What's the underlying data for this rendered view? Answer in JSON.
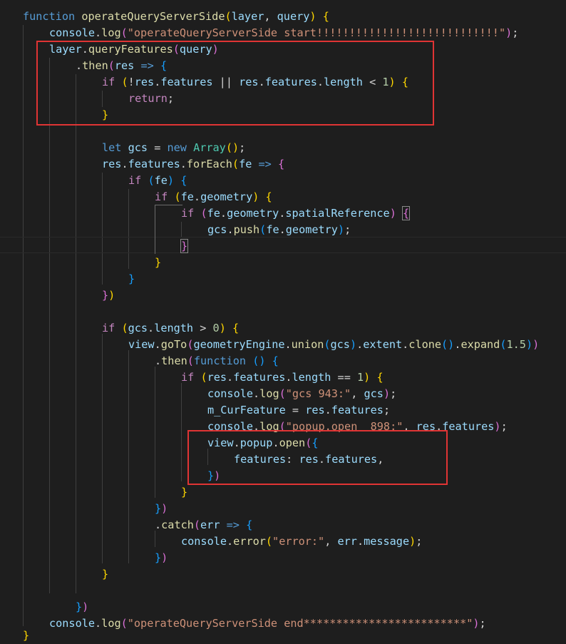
{
  "code_lines": [
    "function operateQueryServerSide(layer, query) {",
    "console.log(\"operateQueryServerSide start!!!!!!!!!!!!!!!!!!!!!!!!!!!!\");",
    "layer.queryFeatures(query)",
    ".then(res => {",
    "if (!res.features || res.features.length < 1) {",
    "return;",
    "}",
    "",
    "let gcs = new Array();",
    "res.features.forEach(fe => {",
    "if (fe) {",
    "if (fe.geometry) {",
    "if (fe.geometry.spatialReference) {",
    "gcs.push(fe.geometry);",
    "}",
    "}",
    "}",
    "})",
    "",
    "if (gcs.length > 0) {",
    "view.goTo(geometryEngine.union(gcs).extent.clone().expand(1.5))",
    ".then(function () {",
    "if (res.features.length == 1) {",
    "console.log(\"gcs 943:\", gcs);",
    "m_CurFeature = res.features;",
    "console.log(\"popup.open  898:\", res.features);",
    "view.popup.open({",
    "features: res.features,",
    "})",
    "}",
    "})",
    ".catch(err => {",
    "console.error(\"error:\", err.message);",
    "})",
    "}",
    "",
    "})",
    "console.log(\"operateQueryServerSide end*************************\");",
    "}"
  ]
}
